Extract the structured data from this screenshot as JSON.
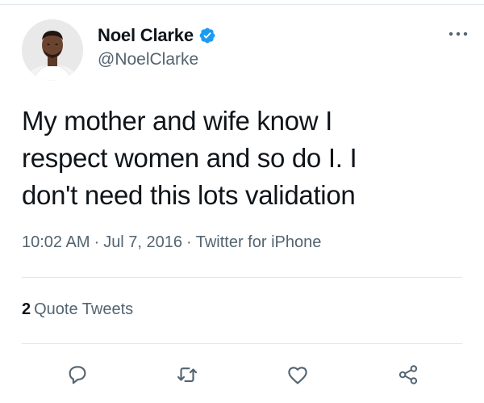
{
  "tweet": {
    "author": {
      "display_name": "Noel Clarke",
      "handle": "@NoelClarke",
      "verified": true,
      "avatar_icon": "profile-photo"
    },
    "text_lines": [
      "My mother and wife know I",
      "respect women and so do I. I",
      "don't need this lots validation"
    ],
    "time": "10:02 AM",
    "date": "Jul 7, 2016",
    "source": "Twitter for iPhone",
    "separator": "·",
    "quote_tweets": {
      "count": "2",
      "label": "Quote Tweets"
    },
    "actions": [
      {
        "name": "reply",
        "icon": "reply-icon"
      },
      {
        "name": "retweet",
        "icon": "retweet-icon"
      },
      {
        "name": "like",
        "icon": "heart-icon"
      },
      {
        "name": "share",
        "icon": "share-icon"
      }
    ]
  },
  "colors": {
    "text": "#0f1419",
    "secondary": "#536471",
    "verified_blue": "#1d9bf0",
    "divider": "#e1e8ed"
  }
}
